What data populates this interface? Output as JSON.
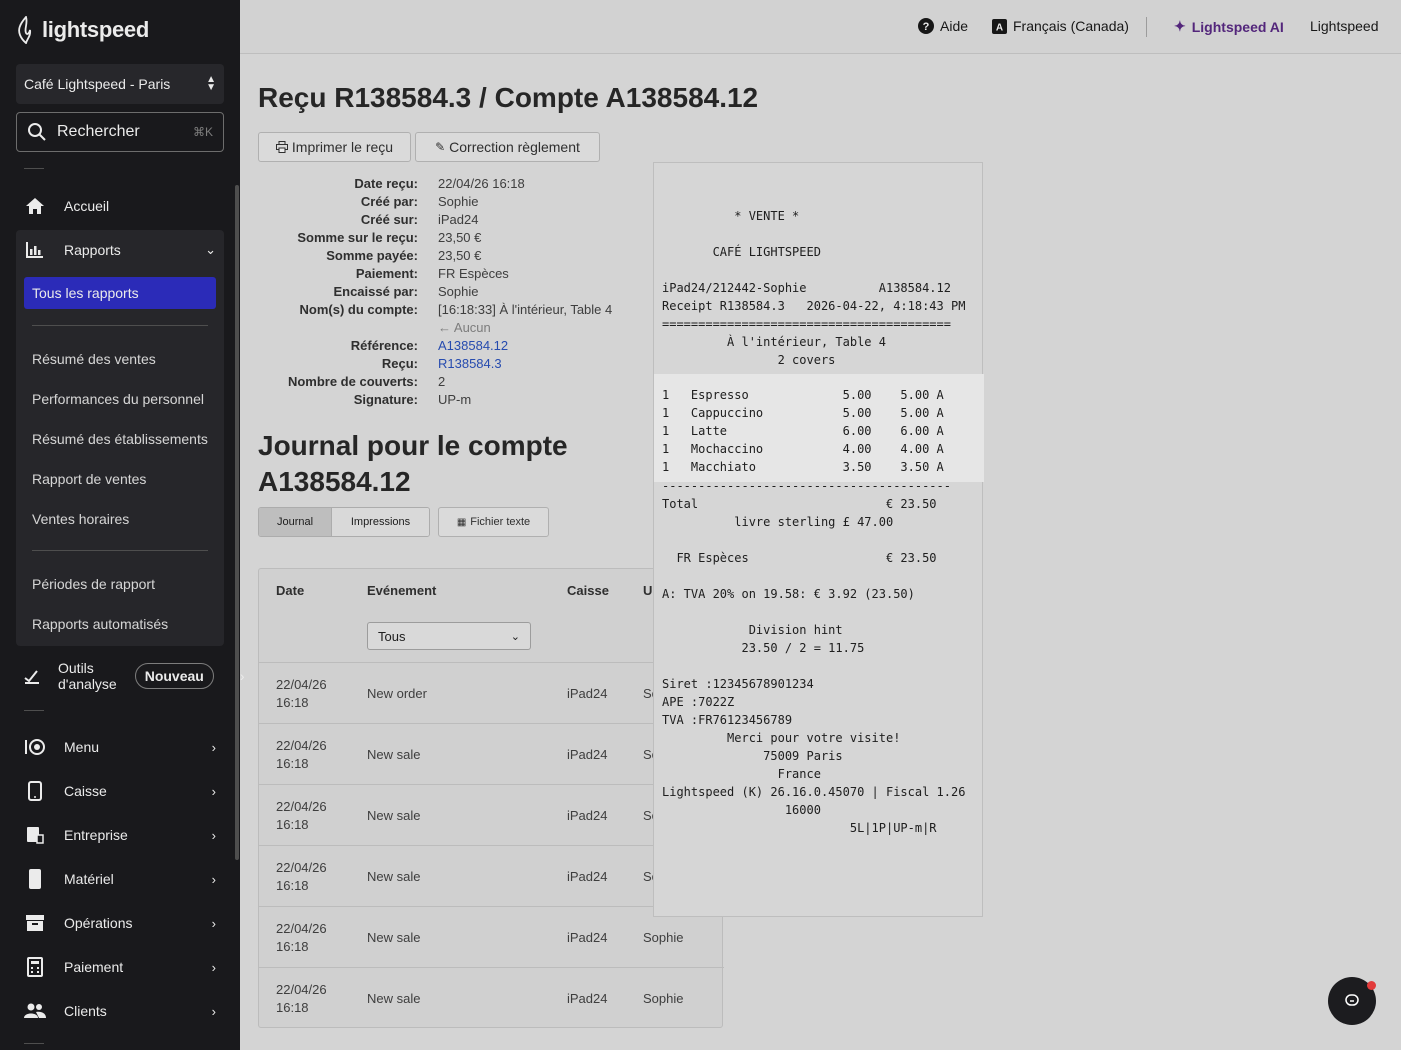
{
  "sidebar": {
    "brand": "lightspeed",
    "store": "Café Lightspeed - Paris",
    "search_label": "Rechercher",
    "search_shortcut": "⌘K",
    "nav": {
      "home": "Accueil",
      "reports": "Rapports",
      "menu": "Menu",
      "register": "Caisse",
      "business": "Entreprise",
      "hardware": "Matériel",
      "operations": "Opérations",
      "payment": "Paiement",
      "clients": "Clients"
    },
    "reports_sub": {
      "active": "Tous les rapports",
      "group1": [
        "Résumé des ventes",
        "Performances du personnel",
        "Résumé des établissements",
        "Rapport de ventes",
        "Ventes horaires"
      ],
      "group2": [
        "Périodes de rapport",
        "Rapports automatisés"
      ]
    },
    "analytics_label_1": "Outils",
    "analytics_label_2": "d'analyse",
    "new_badge": "Nouveau"
  },
  "topbar": {
    "help": "Aide",
    "language": "Français (Canada)",
    "ai": "Lightspeed AI",
    "account": "Lightspeed"
  },
  "page": {
    "title": "Reçu R138584.3 / Compte A138584.12",
    "print_button": "Imprimer le reçu",
    "correction_button": "Correction règlement"
  },
  "details": [
    {
      "k": "Date reçu:",
      "v": "22/04/26 16:18"
    },
    {
      "k": "Créé par:",
      "v": "Sophie"
    },
    {
      "k": "Créé sur:",
      "v": "iPad24"
    },
    {
      "k": "Somme sur le reçu:",
      "v": "23,50 €"
    },
    {
      "k": "Somme payée:",
      "v": "23,50 €"
    },
    {
      "k": "Paiement:",
      "v": "FR Espèces"
    },
    {
      "k": "Encaissé par:",
      "v": "Sophie"
    },
    {
      "k": "Nom(s) du compte:",
      "v": "[16:18:33] À l'intérieur, Table 4"
    },
    {
      "k": "",
      "v": "← Aucun"
    },
    {
      "k": "Référence:",
      "v": "A138584.12"
    },
    {
      "k": "Reçu:",
      "v": "R138584.3"
    },
    {
      "k": "Nombre de couverts:",
      "v": "2"
    },
    {
      "k": "Signature:",
      "v": "UP-m"
    }
  ],
  "journal": {
    "title": "Journal pour le compte A138584.12",
    "tab_journal": "Journal",
    "tab_prints": "Impressions",
    "text_file_button": "Fichier texte",
    "columns": {
      "date": "Date",
      "event": "Evénement",
      "register": "Caisse",
      "user": "U"
    },
    "filter_value": "Tous",
    "rows": [
      {
        "date1": "22/04/26",
        "date2": "16:18",
        "event": "New order",
        "register": "iPad24",
        "user": "So"
      },
      {
        "date1": "22/04/26",
        "date2": "16:18",
        "event": "New sale",
        "register": "iPad24",
        "user": "So"
      },
      {
        "date1": "22/04/26",
        "date2": "16:18",
        "event": "New sale",
        "register": "iPad24",
        "user": "So"
      },
      {
        "date1": "22/04/26",
        "date2": "16:18",
        "event": "New sale",
        "register": "iPad24",
        "user": "So"
      },
      {
        "date1": "22/04/26",
        "date2": "16:18",
        "event": "New sale",
        "register": "iPad24",
        "user": "Sophie"
      },
      {
        "date1": "22/04/26",
        "date2": "16:18",
        "event": "New sale",
        "register": "iPad24",
        "user": "Sophie"
      }
    ]
  },
  "receipt": {
    "lines_top": [
      "          * VENTE *",
      "",
      "       CAFÉ LIGHTSPEED",
      "",
      "iPad24/212442-Sophie          A138584.12",
      "Receipt R138584.3   2026-04-22, 4:18:43 PM",
      "========================================",
      "         À l'intérieur, Table 4",
      "                2 covers"
    ],
    "items": [
      "1   Espresso             5.00    5.00 A",
      "1   Cappuccino           5.00    5.00 A",
      "1   Latte                6.00    6.00 A",
      "1   Mochaccino           4.00    4.00 A",
      "1   Macchiato            3.50    3.50 A"
    ],
    "lines_bottom": [
      "----------------------------------------",
      "Total                          € 23.50",
      "          livre sterling £ 47.00",
      "",
      "  FR Espèces                   € 23.50",
      "",
      "A: TVA 20% on 19.58: € 3.92 (23.50)",
      "",
      "            Division hint",
      "           23.50 / 2 = 11.75",
      "",
      "Siret :12345678901234",
      "APE :7022Z",
      "TVA :FR76123456789",
      "         Merci pour votre visite!",
      "              75009 Paris",
      "                France",
      "Lightspeed (K) 26.16.0.45070 | Fiscal 1.26",
      "                 16000",
      "                          5L|1P|UP-m|R"
    ]
  }
}
